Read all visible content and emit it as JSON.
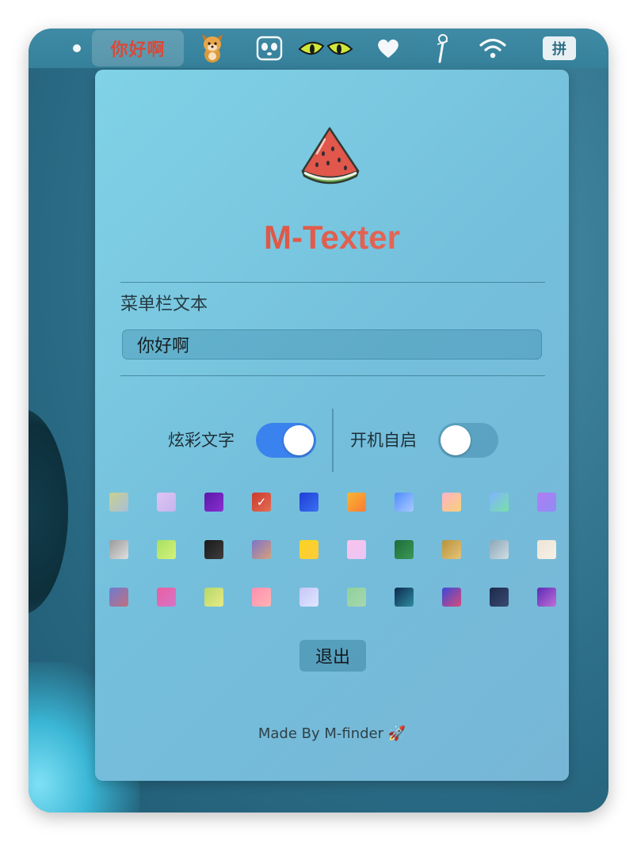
{
  "menubar": {
    "status_text": "你好啊",
    "input_method_label": "拼"
  },
  "panel": {
    "title": "M-Texter",
    "section_label": "菜单栏文本",
    "text_value": "你好啊",
    "toggles": [
      {
        "label": "炫彩文字",
        "on": true
      },
      {
        "label": "开机自启",
        "on": false
      }
    ],
    "selected_swatch_index": 3,
    "exit_label": "退出",
    "footer_text": "Made By M-finder",
    "footer_icon": "🚀"
  },
  "swatches": [
    [
      "#c9d08f",
      "#a8bfd8"
    ],
    [
      "#e0c3f3",
      "#c4b5ec"
    ],
    [
      "#5b18a8",
      "#8a2fd0"
    ],
    [
      "#cb3a2c",
      "#e46d55"
    ],
    [
      "#1e3fd8",
      "#3a6ff0"
    ],
    [
      "#f7b733",
      "#fc7a35"
    ],
    [
      "#4f8dff",
      "#a9c9ff"
    ],
    [
      "#ffb3c6",
      "#f7d07a"
    ],
    [
      "#7fb3ff",
      "#79e0a8"
    ],
    [
      "#b17cf3",
      "#8f8cf5"
    ],
    [
      "#9a9a9a",
      "#e0e0e0"
    ],
    [
      "#a8e063",
      "#d4f27a"
    ],
    [
      "#1a1a1a",
      "#3d3d3d"
    ],
    [
      "#7c73c8",
      "#d7a07c"
    ],
    [
      "#f9d423",
      "#ffca3a"
    ],
    [
      "#fbc2eb",
      "#e8c7f5"
    ],
    [
      "#1e6b3a",
      "#3a9a56"
    ],
    [
      "#b8933b",
      "#e6c47a"
    ],
    [
      "#8aa7b8",
      "#d3dde3"
    ],
    [
      "#ede4d6",
      "#f6f0e6"
    ],
    [
      "#6c7bd0",
      "#c27080"
    ],
    [
      "#e95fa0",
      "#d674c8"
    ],
    [
      "#b6d86a",
      "#e8ea84"
    ],
    [
      "#ff8eb0",
      "#ffb3b3"
    ],
    [
      "#c6c6f6",
      "#e0e6ff"
    ],
    [
      "#8fd19a",
      "#a7d7b0"
    ],
    [
      "#0d2a4e",
      "#2c8ca0"
    ],
    [
      "#3b4ad8",
      "#d74a7a"
    ],
    [
      "#1c2a4a",
      "#3a4a72"
    ],
    [
      "#5a2bb5",
      "#c36ed6"
    ]
  ]
}
